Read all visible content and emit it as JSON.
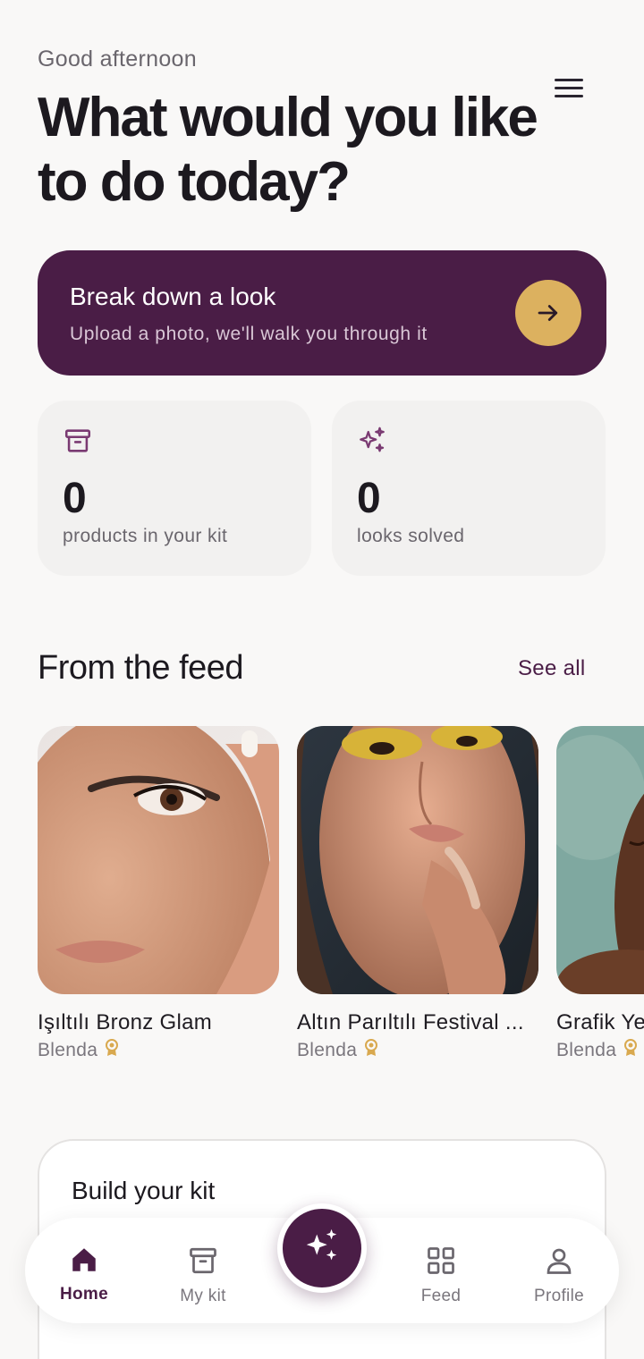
{
  "header": {
    "greeting": "Good afternoon",
    "headline": "What would you like to do today?"
  },
  "hero": {
    "title": "Break down a look",
    "subtitle": "Upload a photo, we'll walk you through it"
  },
  "stats": [
    {
      "value": "0",
      "label": "products in your kit",
      "icon": "archive-box-icon"
    },
    {
      "value": "0",
      "label": "looks solved",
      "icon": "sparkles-icon"
    }
  ],
  "feed": {
    "title": "From the feed",
    "see_all": "See all",
    "items": [
      {
        "title": "Işıltılı Bronz Glam",
        "author": "Blenda"
      },
      {
        "title": "Altın Parıltılı Festival ...",
        "author": "Blenda"
      },
      {
        "title": "Grafik Ye",
        "author": "Blenda"
      }
    ]
  },
  "kit": {
    "title": "Build your kit"
  },
  "nav": {
    "items": [
      {
        "label": "Home",
        "icon": "home-icon",
        "active": true
      },
      {
        "label": "My kit",
        "icon": "archive-box-icon"
      },
      {
        "label": "Feed",
        "icon": "grid-icon"
      },
      {
        "label": "Profile",
        "icon": "person-icon"
      }
    ]
  },
  "colors": {
    "primary": "#4a1d46",
    "accent": "#dcb15f",
    "background": "#f9f8f7"
  }
}
